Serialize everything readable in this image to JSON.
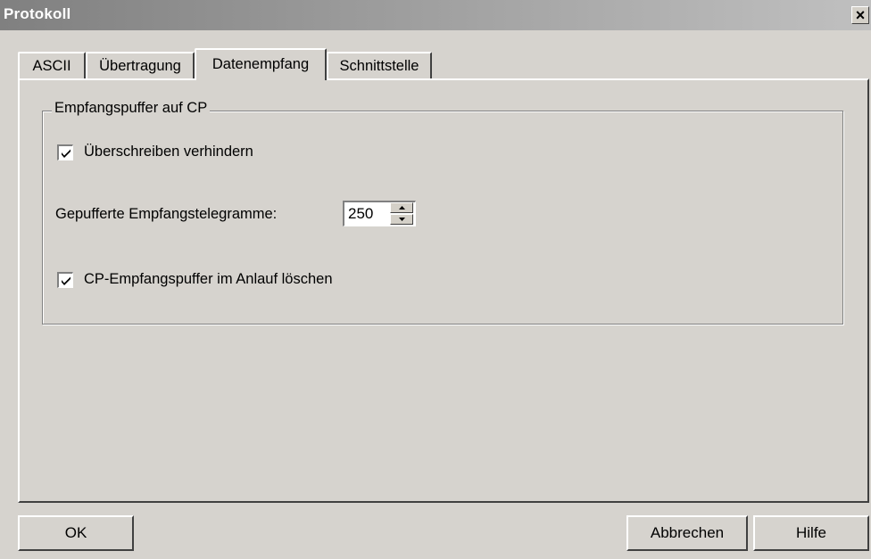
{
  "window": {
    "title": "Protokoll",
    "close_glyph": "×"
  },
  "tabs": [
    {
      "label": "ASCII",
      "active": false
    },
    {
      "label": "Übertragung",
      "active": false
    },
    {
      "label": "Datenempfang",
      "active": true
    },
    {
      "label": "Schnittstelle",
      "active": false
    }
  ],
  "group": {
    "title": "Empfangspuffer auf CP",
    "overwrite_checkbox": {
      "label": "Überschreiben verhindern",
      "checked": true
    },
    "buffered_telegrams": {
      "label": "Gepufferte Empfangstelegramme:",
      "value": "250"
    },
    "clear_on_startup_checkbox": {
      "label": "CP-Empfangspuffer im Anlauf löschen",
      "checked": true
    }
  },
  "buttons": {
    "ok": "OK",
    "cancel": "Abbrechen",
    "help": "Hilfe"
  },
  "colors": {
    "face": "#d6d3ce",
    "title_gradient_start": "#808080",
    "shadow": "#404040",
    "highlight": "#ffffff"
  }
}
